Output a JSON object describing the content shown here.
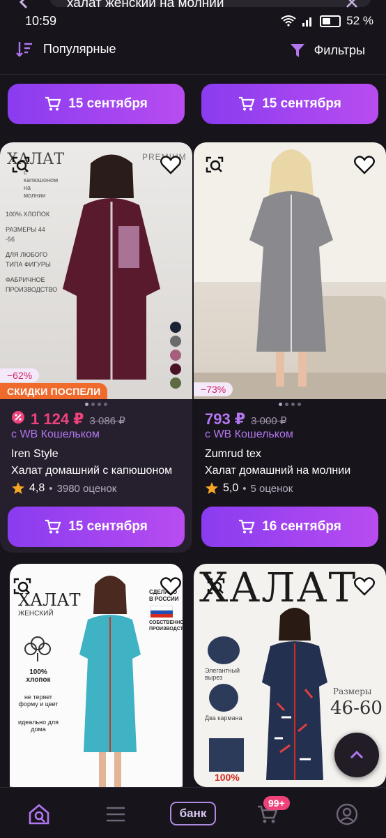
{
  "search": {
    "query": "халат женский на молнии"
  },
  "status_bar": {
    "time": "10:59",
    "battery": "52 %"
  },
  "controls": {
    "sort_label": "Популярные",
    "filters_label": "Фильтры"
  },
  "top_delivery": [
    "15 сентября",
    "15 сентября"
  ],
  "products": [
    {
      "discount": "−62%",
      "promo": "СКИДКИ ПОСПЕЛИ",
      "price": "1 124 ₽",
      "old_price": "3 086 ₽",
      "wallet": "с WB Кошельком",
      "brand": "Iren Style",
      "name": "Халат домашний с капюшоном",
      "rating": "4,8",
      "reviews": "3980 оценок",
      "delivery": "15 сентября"
    },
    {
      "discount": "−73%",
      "price": "793 ₽",
      "old_price": "3 000 ₽",
      "wallet": "с WB Кошельком",
      "brand": "Zumrud tex",
      "name": "Халат домашний на молнии",
      "rating": "5,0",
      "reviews": "5 оценок",
      "delivery": "16 сентября"
    }
  ],
  "image_text": {
    "p1": {
      "title": "ХАЛАТ",
      "sub": "с капюшоном на молнии",
      "premium": "PREMIUM",
      "features": [
        "100% ХЛОПОК",
        "РАЗМЕРЫ 44 -56",
        "ДЛЯ ЛЮБОГО ТИПА ФИГУРЫ",
        "ФАБРИЧНОЕ ПРОИЗВОДСТВО"
      ]
    },
    "p3": {
      "title": "ХАЛАТ",
      "sub": "ЖЕНСКИЙ",
      "made": "СДЕЛАНО В РОССИИ",
      "own": "СОБСТВЕННОЕ ПРОИЗВОДСТВО",
      "features": [
        "100% хлопок",
        "не теряет форму и цвет",
        "идеально для дома"
      ]
    },
    "p4": {
      "title": "ХАЛАТ",
      "notes": [
        "Элегантный вырез",
        "Два кармана",
        "100%"
      ],
      "sizes_label": "Размеры",
      "sizes": "46-60"
    }
  },
  "nav": {
    "bank_label": "банк",
    "cart_badge": "99+"
  },
  "colors": {
    "accent": "#8a3cf0",
    "price": "#b277f0",
    "sale": "#f0427a",
    "promo": "#f06a2c"
  }
}
